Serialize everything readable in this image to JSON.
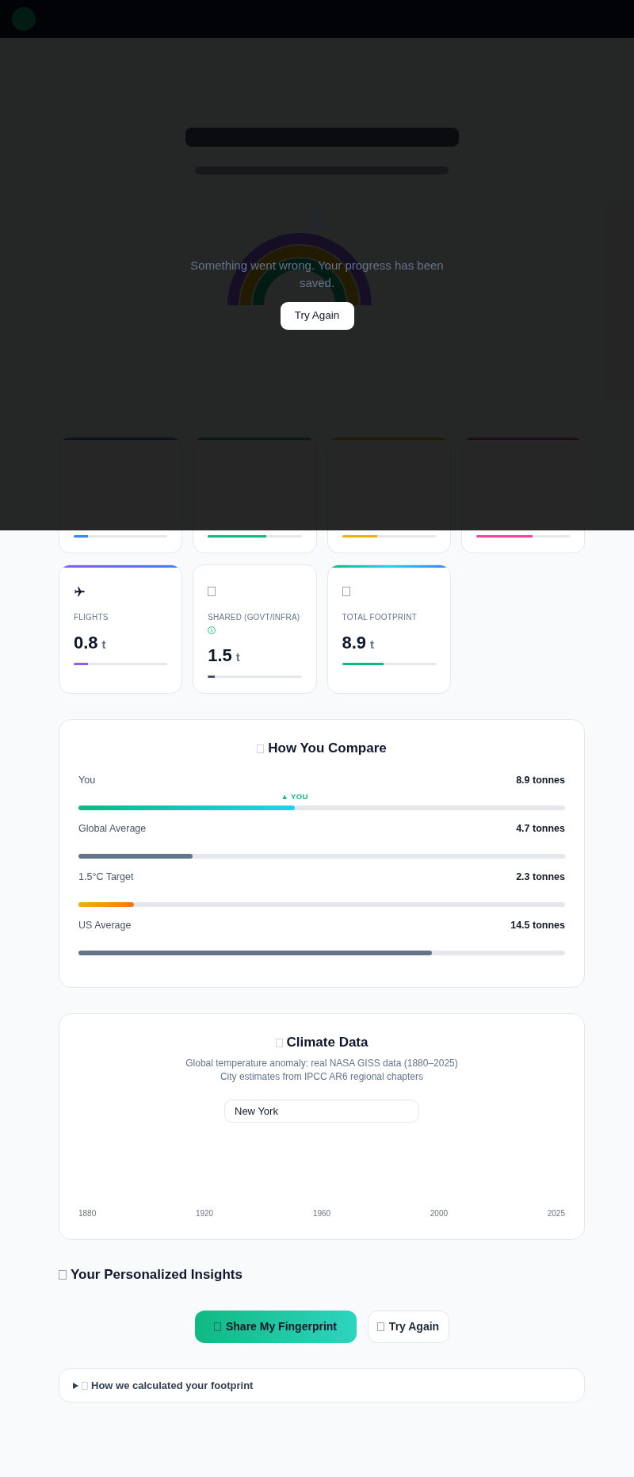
{
  "cards": [
    {
      "color": "#3b82f6",
      "level": 0.15
    },
    {
      "color": "#10b981",
      "level": 0.62
    },
    {
      "color": "#eab308",
      "level": 0.38
    },
    {
      "color": "#ec4899",
      "level": 0.6
    },
    {
      "kind": "flights",
      "label": "FLIGHTS",
      "value": "0.8",
      "unit": "t",
      "color": "#8b5cf6",
      "level": 0.15
    },
    {
      "kind": "shared",
      "label": "SHARED (GOVT/INFRA)",
      "info": true,
      "value": "1.5",
      "unit": "t",
      "color": "#475569",
      "level": 0.07
    },
    {
      "kind": "total",
      "label": "TOTAL FOOTPRINT",
      "value": "8.9",
      "unit": "t",
      "color": "#10b981",
      "level": 0.445
    }
  ],
  "compare": {
    "title": "How You Compare",
    "rows": [
      {
        "kind": "user",
        "label": "You",
        "value": "8.9 tonnes",
        "marker": "▲ YOU",
        "level": 0.444
      },
      {
        "kind": "average",
        "label": "Global Average",
        "value": "4.7 tonnes",
        "level": 0.235
      },
      {
        "kind": "target",
        "label": "1.5°C Target",
        "value": "2.3 tonnes",
        "level": 0.114
      },
      {
        "kind": "average",
        "label": "US Average",
        "value": "14.5 tonnes",
        "level": 0.726
      }
    ]
  },
  "climate": {
    "title": "Climate Data",
    "subtitle": [
      "Global temperature anomaly: real NASA GISS data (1880–2025)",
      "City estimates from IPCC AR6 regional chapters"
    ],
    "city_field": {
      "value": "New York"
    },
    "axis_labels": [
      "1880",
      "1920",
      "1960",
      "2000",
      "2025"
    ]
  },
  "insights": {
    "title": "Your Personalized Insights"
  },
  "actions": [
    {
      "kind": "primary",
      "label": "Share My Fingerprint"
    },
    {
      "kind": "secondary",
      "label": "Try Again"
    }
  ],
  "details": {
    "summary": "How we calculated your footprint",
    "expanded": false
  },
  "error": {
    "message": "Something went wrong. Your progress has been saved.",
    "button": "Try Again"
  }
}
